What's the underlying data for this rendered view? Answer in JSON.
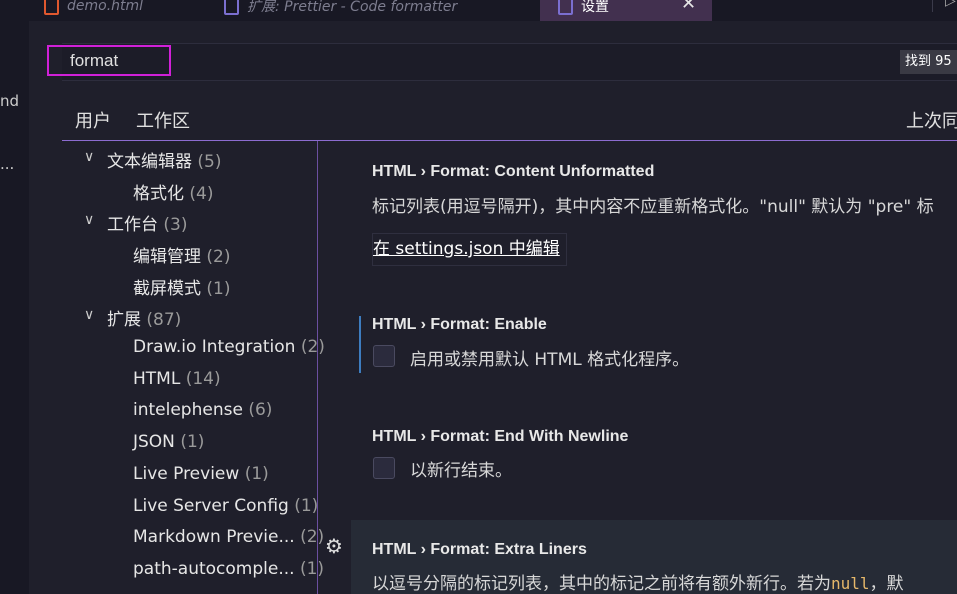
{
  "tabs": [
    {
      "label": "demo.html",
      "icon": "html-file-icon"
    },
    {
      "label": "扩展: Prettier - Code formatter",
      "icon": "extension-icon"
    },
    {
      "label": "设置",
      "icon": "settings-file-icon",
      "active": true
    }
  ],
  "left_fragments": {
    "t1": "nd",
    "t2": "..."
  },
  "search": {
    "value": "format",
    "results_badge": "找到 95"
  },
  "scopes": {
    "user": "用户",
    "workspace": "工作区",
    "last_sync": "上次同"
  },
  "toc": [
    {
      "label": "文本编辑器",
      "count": "(5)",
      "level": 0,
      "expanded": true
    },
    {
      "label": "格式化",
      "count": "(4)",
      "level": 1
    },
    {
      "label": "工作台",
      "count": "(3)",
      "level": 0,
      "expanded": true
    },
    {
      "label": "编辑管理",
      "count": "(2)",
      "level": 1
    },
    {
      "label": "截屏模式",
      "count": "(1)",
      "level": 1
    },
    {
      "label": "扩展",
      "count": "(87)",
      "level": 0,
      "expanded": true
    },
    {
      "label": "Draw.io Integration",
      "count": "(2)",
      "level": 1
    },
    {
      "label": "HTML",
      "count": "(14)",
      "level": 1
    },
    {
      "label": "intelephense",
      "count": "(6)",
      "level": 1
    },
    {
      "label": "JSON",
      "count": "(1)",
      "level": 1
    },
    {
      "label": "Live Preview",
      "count": "(1)",
      "level": 1
    },
    {
      "label": "Live Server Config",
      "count": "(1)",
      "level": 1
    },
    {
      "label": "Markdown Previe...",
      "count": "(2)",
      "level": 1
    },
    {
      "label": "path-autocomple...",
      "count": "(1)",
      "level": 1
    }
  ],
  "settings": [
    {
      "title": "HTML › Format: Content Unformatted",
      "description": "标记列表(用逗号隔开)，其中内容不应重新格式化。\"null\" 默认为 \"pre\" 标",
      "link": "在 settings.json 中编辑"
    },
    {
      "title": "HTML › Format: Enable",
      "description": "启用或禁用默认 HTML 格式化程序。",
      "checked": false
    },
    {
      "title": "HTML › Format: End With Newline",
      "description": "以新行结束。",
      "checked": false
    },
    {
      "title": "HTML › Format: Extra Liners",
      "description_prefix": "以逗号分隔的标记列表，其中的标记之前将有额外新行。若为",
      "description_code": "null",
      "description_suffix": "，默"
    }
  ],
  "colors": {
    "accent": "#8c6cd0",
    "search_highlight": "#d020d8",
    "focus": "#3d7cbf"
  }
}
